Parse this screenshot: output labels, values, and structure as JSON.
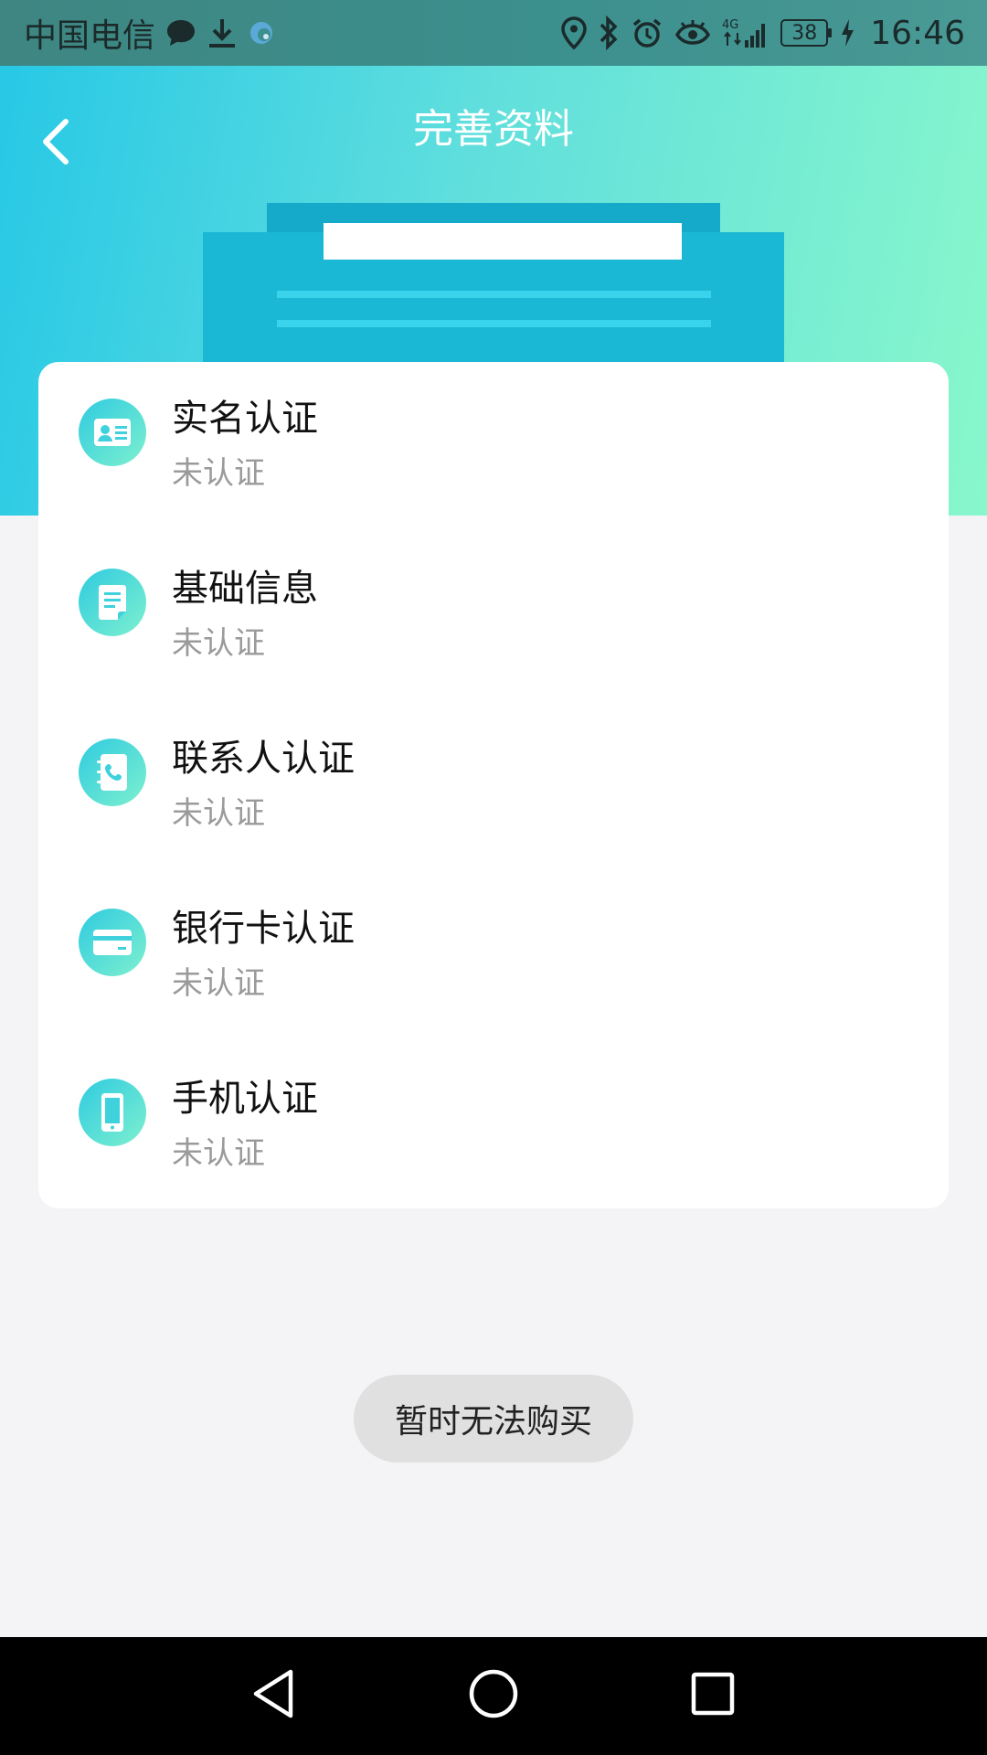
{
  "status_bar": {
    "carrier": "中国电信",
    "network": "4G",
    "battery": "38",
    "time": "16:46"
  },
  "header": {
    "title": "完善资料",
    "back_icon": "chevron-left-icon"
  },
  "items": [
    {
      "title": "实名认证",
      "status": "未认证",
      "icon": "id-card-icon"
    },
    {
      "title": "基础信息",
      "status": "未认证",
      "icon": "document-icon"
    },
    {
      "title": "联系人认证",
      "status": "未认证",
      "icon": "contacts-phone-icon"
    },
    {
      "title": "银行卡认证",
      "status": "未认证",
      "icon": "bank-card-icon"
    },
    {
      "title": "手机认证",
      "status": "未认证",
      "icon": "mobile-phone-icon"
    }
  ],
  "toast": "暂时无法购买",
  "colors": {
    "header_start": "#27c8e6",
    "header_end": "#88f7cb",
    "status_text": "#9a9a9a",
    "page_background": "#f4f3f6"
  }
}
